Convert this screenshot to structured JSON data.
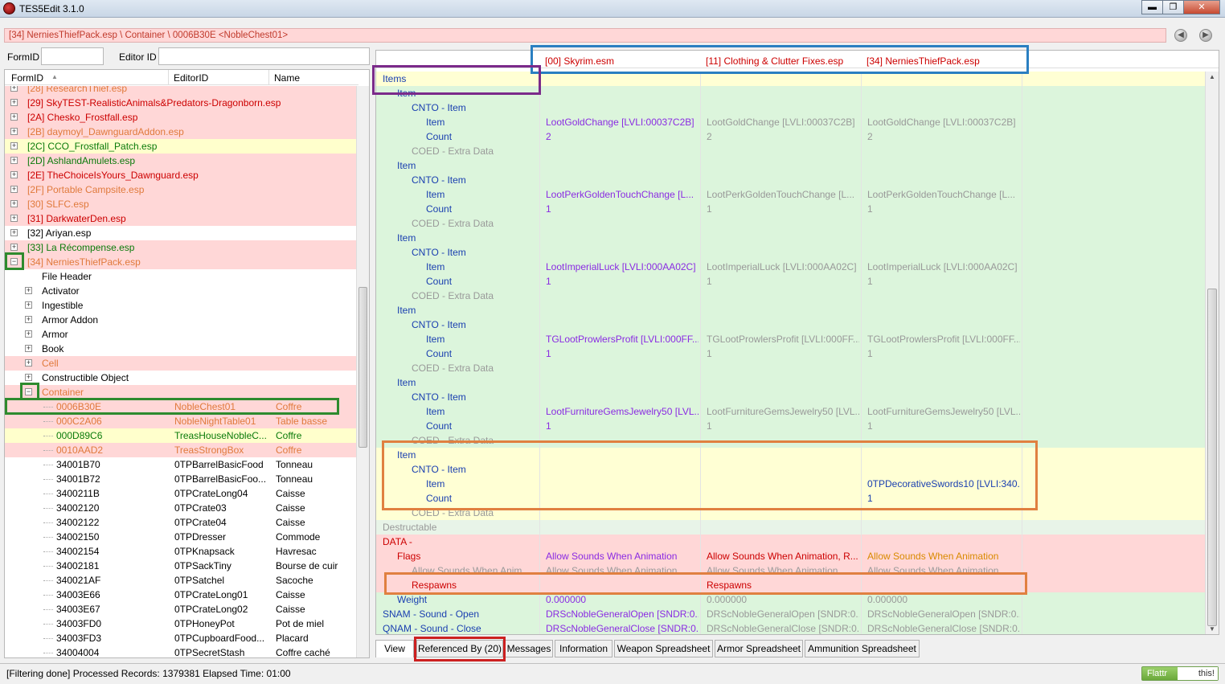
{
  "window": {
    "title": "TES5Edit 3.1.0",
    "min": "▬",
    "max": "❐",
    "close": "✕"
  },
  "path": "[34] NerniesThiefPack.esp \\ Container \\ 0006B30E <NobleChest01>",
  "nav": {
    "back": "◀",
    "forward": "▶"
  },
  "filter": {
    "formid_label": "FormID",
    "formid_value": "",
    "editorid_label": "Editor ID",
    "editorid_value": ""
  },
  "tree": {
    "headers": [
      "FormID",
      "EditorID",
      "Name"
    ],
    "rows": [
      {
        "level": 0,
        "pm": "+",
        "text": "[28] ResearchThief.esp",
        "cls": "c-orange",
        "bg": "bg-pink"
      },
      {
        "level": 0,
        "pm": "+",
        "text": "[29] SkyTEST-RealisticAnimals&Predators-Dragonborn.esp",
        "cls": "c-red",
        "bg": "bg-pink"
      },
      {
        "level": 0,
        "pm": "+",
        "text": "[2A] Chesko_Frostfall.esp",
        "cls": "c-red",
        "bg": "bg-pink"
      },
      {
        "level": 0,
        "pm": "+",
        "text": "[2B] daymoyl_DawnguardAddon.esp",
        "cls": "c-orange",
        "bg": "bg-pink"
      },
      {
        "level": 0,
        "pm": "+",
        "text": "[2C] CCO_Frostfall_Patch.esp",
        "cls": "c-green",
        "bg": "bg-yellow"
      },
      {
        "level": 0,
        "pm": "+",
        "text": "[2D] AshlandAmulets.esp",
        "cls": "c-green",
        "bg": "bg-pink"
      },
      {
        "level": 0,
        "pm": "+",
        "text": "[2E] TheChoiceIsYours_Dawnguard.esp",
        "cls": "c-red",
        "bg": "bg-pink"
      },
      {
        "level": 0,
        "pm": "+",
        "text": "[2F] Portable Campsite.esp",
        "cls": "c-orange",
        "bg": "bg-pink"
      },
      {
        "level": 0,
        "pm": "+",
        "text": "[30] SLFC.esp",
        "cls": "c-orange",
        "bg": "bg-pink"
      },
      {
        "level": 0,
        "pm": "+",
        "text": "[31] DarkwaterDen.esp",
        "cls": "c-red",
        "bg": "bg-pink"
      },
      {
        "level": 0,
        "pm": "+",
        "text": "[32] Ariyan.esp",
        "cls": "c-black",
        "bg": ""
      },
      {
        "level": 0,
        "pm": "+",
        "text": "[33] La Récompense.esp",
        "cls": "c-green",
        "bg": "bg-pink"
      },
      {
        "level": 0,
        "pm": "−",
        "text": "[34] NerniesThiefPack.esp",
        "cls": "c-orange",
        "bg": "bg-pink"
      },
      {
        "level": 1,
        "pm": "",
        "text": "File Header",
        "cls": "c-black",
        "bg": ""
      },
      {
        "level": 1,
        "pm": "+",
        "text": "Activator",
        "cls": "c-black",
        "bg": ""
      },
      {
        "level": 1,
        "pm": "+",
        "text": "Ingestible",
        "cls": "c-black",
        "bg": ""
      },
      {
        "level": 1,
        "pm": "+",
        "text": "Armor Addon",
        "cls": "c-black",
        "bg": ""
      },
      {
        "level": 1,
        "pm": "+",
        "text": "Armor",
        "cls": "c-black",
        "bg": ""
      },
      {
        "level": 1,
        "pm": "+",
        "text": "Book",
        "cls": "c-black",
        "bg": ""
      },
      {
        "level": 1,
        "pm": "+",
        "text": "Cell",
        "cls": "c-orange",
        "bg": "bg-pink"
      },
      {
        "level": 1,
        "pm": "+",
        "text": "Constructible Object",
        "cls": "c-black",
        "bg": ""
      },
      {
        "level": 1,
        "pm": "−",
        "text": "Container",
        "cls": "c-orange",
        "bg": "bg-pink"
      }
    ],
    "records": [
      {
        "formid": "0006B30E",
        "editorid": "NobleChest01",
        "name": "Coffre",
        "cls": "c-orange",
        "bg": "bg-pink"
      },
      {
        "formid": "000C2A06",
        "editorid": "NobleNightTable01",
        "name": "Table basse",
        "cls": "c-orange",
        "bg": "bg-pink"
      },
      {
        "formid": "000D89C6",
        "editorid": "TreasHouseNobleC...",
        "name": "Coffre",
        "cls": "c-green",
        "bg": "bg-yellow"
      },
      {
        "formid": "0010AAD2",
        "editorid": "TreasStrongBox",
        "name": "Coffre",
        "cls": "c-orange",
        "bg": "bg-pink"
      },
      {
        "formid": "34001B70",
        "editorid": "0TPBarrelBasicFood",
        "name": "Tonneau",
        "cls": "c-black",
        "bg": ""
      },
      {
        "formid": "34001B72",
        "editorid": "0TPBarrelBasicFoo...",
        "name": "Tonneau",
        "cls": "c-black",
        "bg": ""
      },
      {
        "formid": "3400211B",
        "editorid": "0TPCrateLong04",
        "name": "Caisse",
        "cls": "c-black",
        "bg": ""
      },
      {
        "formid": "34002120",
        "editorid": "0TPCrate03",
        "name": "Caisse",
        "cls": "c-black",
        "bg": ""
      },
      {
        "formid": "34002122",
        "editorid": "0TPCrate04",
        "name": "Caisse",
        "cls": "c-black",
        "bg": ""
      },
      {
        "formid": "34002150",
        "editorid": "0TPDresser",
        "name": "Commode",
        "cls": "c-black",
        "bg": ""
      },
      {
        "formid": "34002154",
        "editorid": "0TPKnapsack",
        "name": "Havresac",
        "cls": "c-black",
        "bg": ""
      },
      {
        "formid": "34002181",
        "editorid": "0TPSackTiny",
        "name": "Bourse de cuir",
        "cls": "c-black",
        "bg": ""
      },
      {
        "formid": "340021AF",
        "editorid": "0TPSatchel",
        "name": "Sacoche",
        "cls": "c-black",
        "bg": ""
      },
      {
        "formid": "34003E66",
        "editorid": "0TPCrateLong01",
        "name": "Caisse",
        "cls": "c-black",
        "bg": ""
      },
      {
        "formid": "34003E67",
        "editorid": "0TPCrateLong02",
        "name": "Caisse",
        "cls": "c-black",
        "bg": ""
      },
      {
        "formid": "34003FD0",
        "editorid": "0TPHoneyPot",
        "name": "Pot de miel",
        "cls": "c-black",
        "bg": ""
      },
      {
        "formid": "34003FD3",
        "editorid": "0TPCupboardFood...",
        "name": "Placard",
        "cls": "c-black",
        "bg": ""
      },
      {
        "formid": "34004004",
        "editorid": "0TPSecretStash",
        "name": "Coffre caché",
        "cls": "c-black",
        "bg": ""
      }
    ]
  },
  "grid": {
    "headers": [
      "[00] Skyrim.esm",
      "[11] Clothing & Clutter Fixes.esp",
      "[34] NerniesThiefPack.esp"
    ],
    "rows": [
      {
        "indent": 0,
        "label": "Items",
        "lcls": "t-blue",
        "bg": "g-yellow",
        "v": [
          "",
          "",
          ""
        ],
        "vcls": [
          "",
          "",
          ""
        ]
      },
      {
        "indent": 1,
        "label": "Item",
        "lcls": "t-blue",
        "bg": "g-green",
        "v": [
          "",
          "",
          ""
        ],
        "vcls": [
          "",
          "",
          ""
        ]
      },
      {
        "indent": 2,
        "label": "CNTO - Item",
        "lcls": "t-blue",
        "bg": "g-green",
        "v": [
          "",
          "",
          ""
        ],
        "vcls": [
          "",
          "",
          ""
        ]
      },
      {
        "indent": 3,
        "label": "Item",
        "lcls": "t-blue",
        "bg": "g-green",
        "v": [
          "LootGoldChange [LVLI:00037C2B]",
          "LootGoldChange [LVLI:00037C2B]",
          "LootGoldChange [LVLI:00037C2B]"
        ],
        "vcls": [
          "t-purple",
          "t-gray",
          "t-gray"
        ]
      },
      {
        "indent": 3,
        "label": "Count",
        "lcls": "t-blue",
        "bg": "g-green",
        "v": [
          "2",
          "2",
          "2"
        ],
        "vcls": [
          "t-purple",
          "t-gray",
          "t-gray"
        ]
      },
      {
        "indent": 2,
        "label": "COED - Extra Data",
        "lcls": "t-gray",
        "bg": "g-green",
        "v": [
          "",
          "",
          ""
        ],
        "vcls": [
          "",
          "",
          ""
        ]
      },
      {
        "indent": 1,
        "label": "Item",
        "lcls": "t-blue",
        "bg": "g-green",
        "v": [
          "",
          "",
          ""
        ],
        "vcls": [
          "",
          "",
          ""
        ]
      },
      {
        "indent": 2,
        "label": "CNTO - Item",
        "lcls": "t-blue",
        "bg": "g-green",
        "v": [
          "",
          "",
          ""
        ],
        "vcls": [
          "",
          "",
          ""
        ]
      },
      {
        "indent": 3,
        "label": "Item",
        "lcls": "t-blue",
        "bg": "g-green",
        "v": [
          "LootPerkGoldenTouchChange [L...",
          "LootPerkGoldenTouchChange [L...",
          "LootPerkGoldenTouchChange [L..."
        ],
        "vcls": [
          "t-purple",
          "t-gray",
          "t-gray"
        ]
      },
      {
        "indent": 3,
        "label": "Count",
        "lcls": "t-blue",
        "bg": "g-green",
        "v": [
          "1",
          "1",
          "1"
        ],
        "vcls": [
          "t-purple",
          "t-gray",
          "t-gray"
        ]
      },
      {
        "indent": 2,
        "label": "COED - Extra Data",
        "lcls": "t-gray",
        "bg": "g-green",
        "v": [
          "",
          "",
          ""
        ],
        "vcls": [
          "",
          "",
          ""
        ]
      },
      {
        "indent": 1,
        "label": "Item",
        "lcls": "t-blue",
        "bg": "g-green",
        "v": [
          "",
          "",
          ""
        ],
        "vcls": [
          "",
          "",
          ""
        ]
      },
      {
        "indent": 2,
        "label": "CNTO - Item",
        "lcls": "t-blue",
        "bg": "g-green",
        "v": [
          "",
          "",
          ""
        ],
        "vcls": [
          "",
          "",
          ""
        ]
      },
      {
        "indent": 3,
        "label": "Item",
        "lcls": "t-blue",
        "bg": "g-green",
        "v": [
          "LootImperialLuck [LVLI:000AA02C]",
          "LootImperialLuck [LVLI:000AA02C]",
          "LootImperialLuck [LVLI:000AA02C]"
        ],
        "vcls": [
          "t-purple",
          "t-gray",
          "t-gray"
        ]
      },
      {
        "indent": 3,
        "label": "Count",
        "lcls": "t-blue",
        "bg": "g-green",
        "v": [
          "1",
          "1",
          "1"
        ],
        "vcls": [
          "t-purple",
          "t-gray",
          "t-gray"
        ]
      },
      {
        "indent": 2,
        "label": "COED - Extra Data",
        "lcls": "t-gray",
        "bg": "g-green",
        "v": [
          "",
          "",
          ""
        ],
        "vcls": [
          "",
          "",
          ""
        ]
      },
      {
        "indent": 1,
        "label": "Item",
        "lcls": "t-blue",
        "bg": "g-green",
        "v": [
          "",
          "",
          ""
        ],
        "vcls": [
          "",
          "",
          ""
        ]
      },
      {
        "indent": 2,
        "label": "CNTO - Item",
        "lcls": "t-blue",
        "bg": "g-green",
        "v": [
          "",
          "",
          ""
        ],
        "vcls": [
          "",
          "",
          ""
        ]
      },
      {
        "indent": 3,
        "label": "Item",
        "lcls": "t-blue",
        "bg": "g-green",
        "v": [
          "TGLootProwlersProfit [LVLI:000FF...",
          "TGLootProwlersProfit [LVLI:000FF...",
          "TGLootProwlersProfit [LVLI:000FF..."
        ],
        "vcls": [
          "t-purple",
          "t-gray",
          "t-gray"
        ]
      },
      {
        "indent": 3,
        "label": "Count",
        "lcls": "t-blue",
        "bg": "g-green",
        "v": [
          "1",
          "1",
          "1"
        ],
        "vcls": [
          "t-purple",
          "t-gray",
          "t-gray"
        ]
      },
      {
        "indent": 2,
        "label": "COED - Extra Data",
        "lcls": "t-gray",
        "bg": "g-green",
        "v": [
          "",
          "",
          ""
        ],
        "vcls": [
          "",
          "",
          ""
        ]
      },
      {
        "indent": 1,
        "label": "Item",
        "lcls": "t-blue",
        "bg": "g-green",
        "v": [
          "",
          "",
          ""
        ],
        "vcls": [
          "",
          "",
          ""
        ]
      },
      {
        "indent": 2,
        "label": "CNTO - Item",
        "lcls": "t-blue",
        "bg": "g-green",
        "v": [
          "",
          "",
          ""
        ],
        "vcls": [
          "",
          "",
          ""
        ]
      },
      {
        "indent": 3,
        "label": "Item",
        "lcls": "t-blue",
        "bg": "g-green",
        "v": [
          "LootFurnitureGemsJewelry50 [LVL...",
          "LootFurnitureGemsJewelry50 [LVL...",
          "LootFurnitureGemsJewelry50 [LVL..."
        ],
        "vcls": [
          "t-purple",
          "t-gray",
          "t-gray"
        ]
      },
      {
        "indent": 3,
        "label": "Count",
        "lcls": "t-blue",
        "bg": "g-green",
        "v": [
          "1",
          "1",
          "1"
        ],
        "vcls": [
          "t-purple",
          "t-gray",
          "t-gray"
        ]
      },
      {
        "indent": 2,
        "label": "COED - Extra Data",
        "lcls": "t-gray",
        "bg": "g-green",
        "v": [
          "",
          "",
          ""
        ],
        "vcls": [
          "",
          "",
          ""
        ]
      },
      {
        "indent": 1,
        "label": "Item",
        "lcls": "t-blue",
        "bg": "g-yellow",
        "v": [
          "",
          "",
          ""
        ],
        "vcls": [
          "",
          "",
          ""
        ]
      },
      {
        "indent": 2,
        "label": "CNTO - Item",
        "lcls": "t-blue",
        "bg": "g-yellow",
        "v": [
          "",
          "",
          ""
        ],
        "vcls": [
          "",
          "",
          ""
        ]
      },
      {
        "indent": 3,
        "label": "Item",
        "lcls": "t-blue",
        "bg": "g-yellow",
        "v": [
          "",
          "",
          "0TPDecorativeSwords10 [LVLI:340..."
        ],
        "vcls": [
          "",
          "",
          "t-blue"
        ]
      },
      {
        "indent": 3,
        "label": "Count",
        "lcls": "t-blue",
        "bg": "g-yellow",
        "v": [
          "",
          "",
          "1"
        ],
        "vcls": [
          "",
          "",
          "t-blue"
        ]
      },
      {
        "indent": 2,
        "label": "COED - Extra Data",
        "lcls": "t-gray",
        "bg": "g-yellow",
        "v": [
          "",
          "",
          ""
        ],
        "vcls": [
          "",
          "",
          ""
        ]
      },
      {
        "indent": 0,
        "label": "Destructable",
        "lcls": "t-gray",
        "bg": "g-gray",
        "v": [
          "",
          "",
          ""
        ],
        "vcls": [
          "",
          "",
          ""
        ]
      },
      {
        "indent": 0,
        "label": "DATA -",
        "lcls": "t-red",
        "bg": "g-pink",
        "v": [
          "",
          "",
          ""
        ],
        "vcls": [
          "",
          "",
          ""
        ]
      },
      {
        "indent": 1,
        "label": "Flags",
        "lcls": "t-red",
        "bg": "g-pink",
        "v": [
          "Allow Sounds When Animation",
          "Allow Sounds When Animation, R...",
          "Allow Sounds When Animation"
        ],
        "vcls": [
          "t-purple",
          "t-red",
          "t-orange"
        ]
      },
      {
        "indent": 2,
        "label": "Allow Sounds When Anim...",
        "lcls": "t-gray",
        "bg": "g-pink",
        "v": [
          "Allow Sounds When Animation",
          "Allow Sounds When Animation",
          "Allow Sounds When Animation"
        ],
        "vcls": [
          "t-gray",
          "t-gray",
          "t-gray"
        ]
      },
      {
        "indent": 2,
        "label": "Respawns",
        "lcls": "t-red",
        "bg": "g-pink",
        "v": [
          "",
          "Respawns",
          ""
        ],
        "vcls": [
          "",
          "t-red",
          ""
        ]
      },
      {
        "indent": 1,
        "label": "Weight",
        "lcls": "t-blue",
        "bg": "g-green",
        "v": [
          "0.000000",
          "0.000000",
          "0.000000"
        ],
        "vcls": [
          "t-purple",
          "t-gray",
          "t-gray"
        ]
      },
      {
        "indent": 0,
        "label": "SNAM - Sound - Open",
        "lcls": "t-blue",
        "bg": "g-green",
        "v": [
          "DRScNobleGeneralOpen [SNDR:0...",
          "DRScNobleGeneralOpen [SNDR:0...",
          "DRScNobleGeneralOpen [SNDR:0..."
        ],
        "vcls": [
          "t-purple",
          "t-gray",
          "t-gray"
        ]
      },
      {
        "indent": 0,
        "label": "QNAM - Sound - Close",
        "lcls": "t-blue",
        "bg": "g-green",
        "v": [
          "DRScNobleGeneralClose [SNDR:0...",
          "DRScNobleGeneralClose [SNDR:0...",
          "DRScNobleGeneralClose [SNDR:0..."
        ],
        "vcls": [
          "t-purple",
          "t-gray",
          "t-gray"
        ]
      }
    ]
  },
  "tabs": [
    "View",
    "Referenced By (20)",
    "Messages",
    "Information",
    "Weapon Spreadsheet",
    "Armor Spreadsheet",
    "Ammunition Spreadsheet"
  ],
  "status": "[Filtering done]  Processed Records: 1379381 Elapsed Time: 01:00",
  "flattr": {
    "left": "Flattr",
    "right": "this!"
  },
  "colors": {
    "highlight_blue": "#2a7fc1",
    "highlight_purple": "#7b2a8a",
    "highlight_green": "#2e8b2e",
    "highlight_orange": "#e08040",
    "highlight_red": "#cc2020"
  }
}
